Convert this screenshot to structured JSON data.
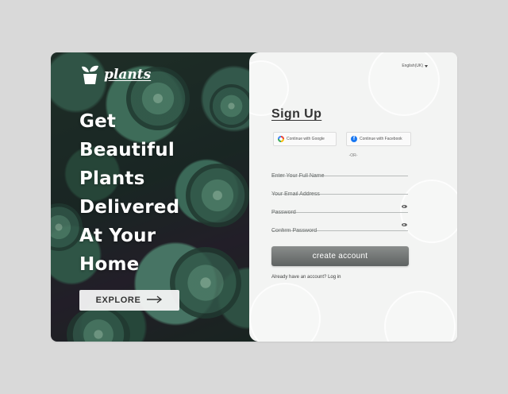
{
  "brand": {
    "name": "plants"
  },
  "hero": {
    "headline_lines": [
      "Get",
      "Beautiful",
      "Plants",
      "Delivered",
      "At Your",
      "Home"
    ],
    "explore_label": "EXPLORE",
    "explore_icon": "arrow-right-icon"
  },
  "language": {
    "label": "English(UK)"
  },
  "form": {
    "title": "Sign Up",
    "google_label": "Continue with Google",
    "facebook_label": "Continue with Facebook",
    "divider": "-OR-",
    "fields": {
      "full_name_placeholder": "Enter Your Full Name",
      "email_placeholder": "Your Email Address",
      "password_placeholder": "Password",
      "confirm_placeholder": "Confirm Password"
    },
    "submit_label": "create account",
    "login_prompt": "Already have an account?",
    "login_link": "Log in"
  },
  "colors": {
    "background": "#d9d9d9",
    "panel": "#f3f4f3",
    "button": "#6f7372",
    "hero_dark": "#1e2c2a",
    "succulent_green": "#4f8a72"
  }
}
